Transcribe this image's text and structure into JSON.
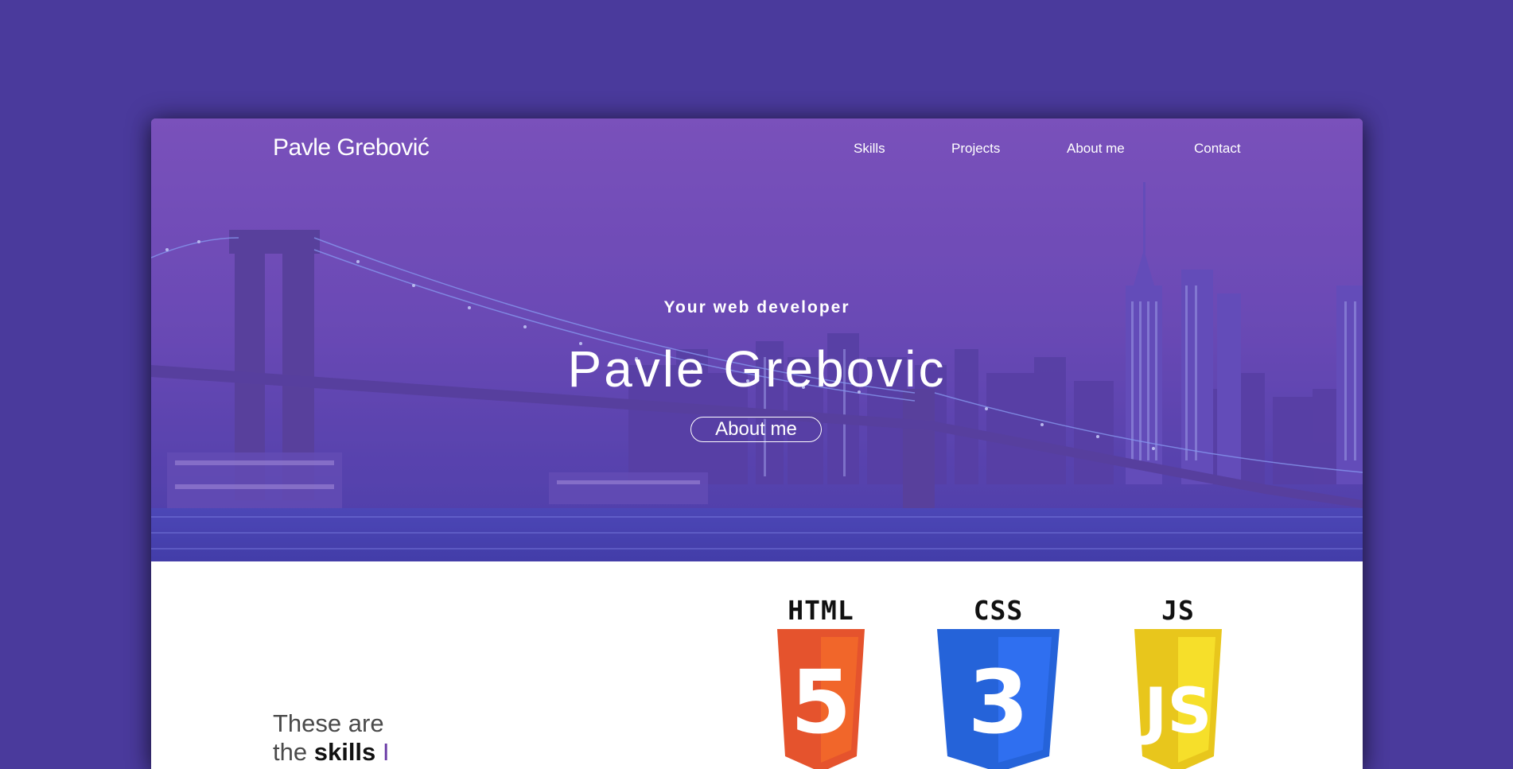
{
  "colors": {
    "background": "#4a3a9c",
    "hero_overlay": "#6a48b4",
    "html_orange": "#e5532d",
    "css_blue": "#2563d9",
    "js_yellow": "#f0d41e"
  },
  "nav": {
    "brand": "Pavle Grebović",
    "links": [
      {
        "label": "Skills"
      },
      {
        "label": "Projects"
      },
      {
        "label": "About me"
      },
      {
        "label": "Contact"
      }
    ]
  },
  "hero": {
    "subtitle": "Your web developer",
    "title": "Pavle Grebovic",
    "button_label": "About me"
  },
  "skills": {
    "line1": "These are",
    "line2_prefix": "the ",
    "line2_bold": "skills",
    "cursor": "I",
    "badges": [
      {
        "label": "HTML",
        "glyph": "5",
        "icon": "html5-shield-icon"
      },
      {
        "label": "CSS",
        "glyph": "3",
        "icon": "css3-shield-icon"
      },
      {
        "label": "JS",
        "glyph": "JS",
        "icon": "js-shield-icon"
      }
    ]
  }
}
